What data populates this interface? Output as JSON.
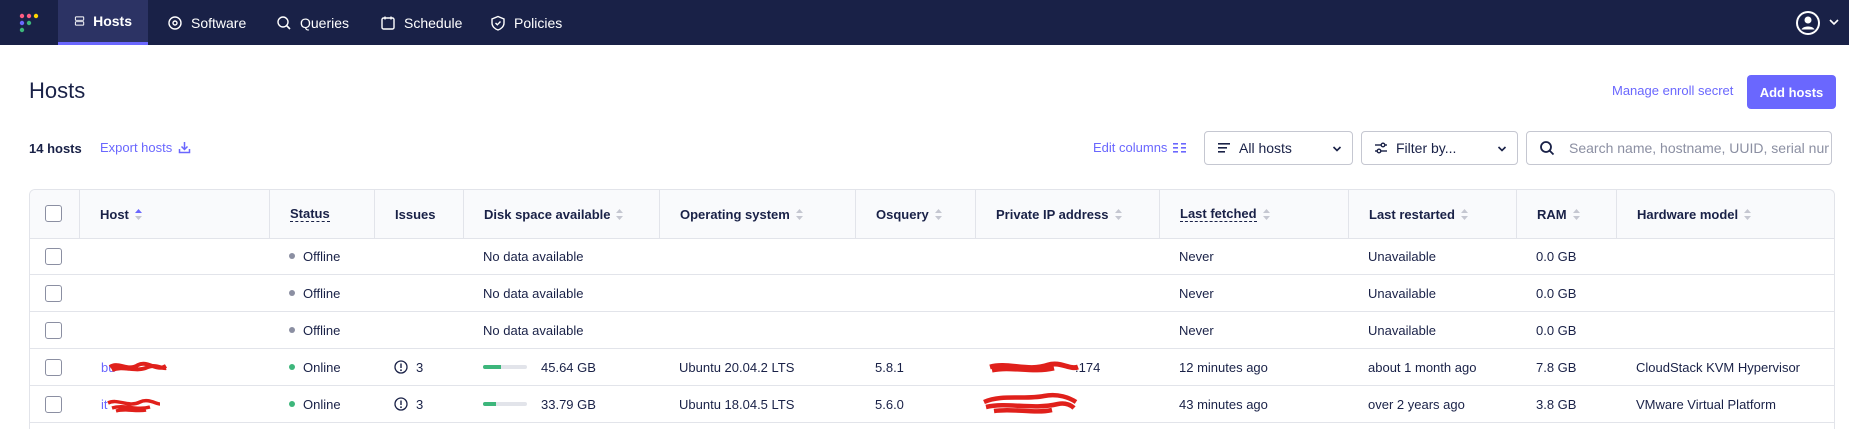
{
  "nav": {
    "items": [
      {
        "label": "Hosts",
        "icon": "hosts-icon",
        "active": true
      },
      {
        "label": "Software",
        "icon": "software-icon",
        "active": false
      },
      {
        "label": "Queries",
        "icon": "queries-icon",
        "active": false
      },
      {
        "label": "Schedule",
        "icon": "schedule-icon",
        "active": false
      },
      {
        "label": "Policies",
        "icon": "policies-icon",
        "active": false
      }
    ],
    "user_menu_icon": "user-avatar-icon"
  },
  "header": {
    "title": "Hosts",
    "manage_enroll_secret": "Manage enroll secret",
    "add_hosts": "Add hosts"
  },
  "toolbar": {
    "host_count": "14 hosts",
    "export_hosts": "Export hosts",
    "edit_columns": "Edit columns",
    "host_filter_selected": "All hosts",
    "filter_by_selected": "Filter by...",
    "search_placeholder": "Search name, hostname, UUID, serial number, or private IP address"
  },
  "table": {
    "columns": [
      "Host",
      "Status",
      "Issues",
      "Disk space available",
      "Operating system",
      "Osquery",
      "Private IP address",
      "Last fetched",
      "Last restarted",
      "RAM",
      "Hardware model"
    ],
    "rows": [
      {
        "host": "",
        "status": "Offline",
        "issues": "",
        "disk": "No data available",
        "disk_fraction": null,
        "os": "",
        "osquery": "",
        "ip": "",
        "last_fetched": "Never",
        "last_restarted": "Unavailable",
        "ram": "0.0 GB",
        "hardware": ""
      },
      {
        "host": "",
        "status": "Offline",
        "issues": "",
        "disk": "No data available",
        "disk_fraction": null,
        "os": "",
        "osquery": "",
        "ip": "",
        "last_fetched": "Never",
        "last_restarted": "Unavailable",
        "ram": "0.0 GB",
        "hardware": ""
      },
      {
        "host": "",
        "status": "Offline",
        "issues": "",
        "disk": "No data available",
        "disk_fraction": null,
        "os": "",
        "osquery": "",
        "ip": "",
        "last_fetched": "Never",
        "last_restarted": "Unavailable",
        "ram": "0.0 GB",
        "hardware": ""
      },
      {
        "host": "bu",
        "status": "Online",
        "issues": "3",
        "disk": "45.64 GB",
        "disk_fraction": 0.4,
        "os": "Ubuntu 20.04.2 LTS",
        "osquery": "5.8.1",
        "ip": ".174",
        "last_fetched": "12 minutes ago",
        "last_restarted": "about 1 month ago",
        "ram": "7.8 GB",
        "hardware": "CloudStack KVM Hypervisor"
      },
      {
        "host": "it",
        "status": "Online",
        "issues": "3",
        "disk": "33.79 GB",
        "disk_fraction": 0.3,
        "os": "Ubuntu 18.04.5 LTS",
        "osquery": "5.6.0",
        "ip": "",
        "last_fetched": "43 minutes ago",
        "last_restarted": "over 2 years ago",
        "ram": "3.8 GB",
        "hardware": "VMware Virtual Platform"
      }
    ]
  },
  "colors": {
    "nav_bg": "#192147",
    "accent": "#6a67fe",
    "online": "#3db67b",
    "offline": "#8b8fa2",
    "redaction": "#e0201b"
  }
}
